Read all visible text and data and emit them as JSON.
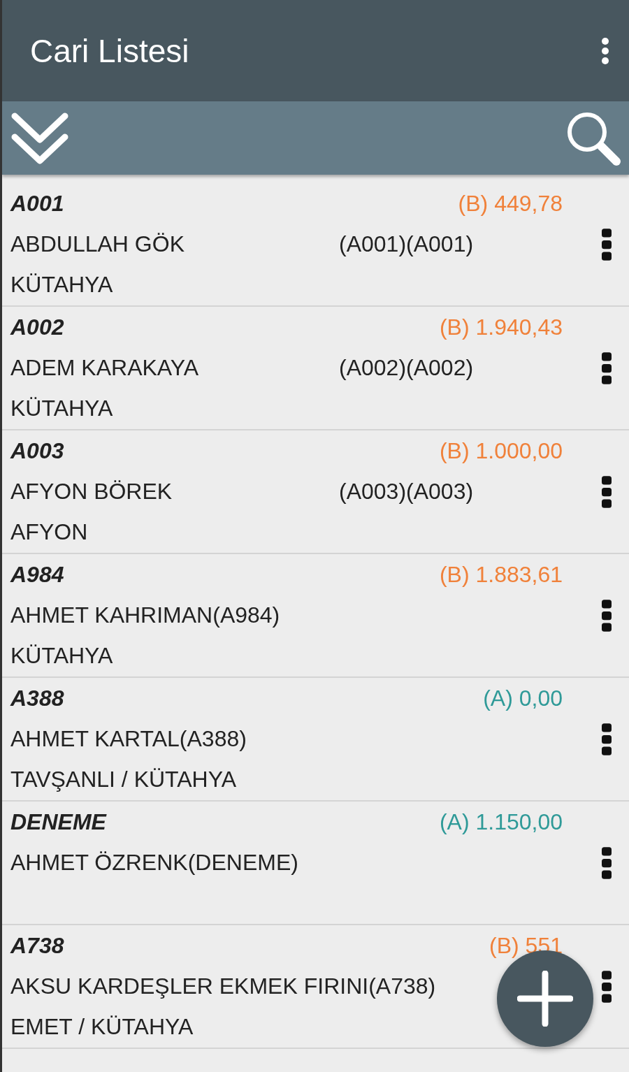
{
  "app_bar": {
    "title": "Cari Listesi"
  },
  "rows": [
    {
      "code": "A001",
      "balance": "(B) 449,78",
      "color": "#f0813a",
      "name": "ABDULLAH GÖK",
      "name_suffix": "(A001)(A001)",
      "city": "KÜTAHYA"
    },
    {
      "code": "A002",
      "balance": "(B) 1.940,43",
      "color": "#f0813a",
      "name": "ADEM KARAKAYA",
      "name_suffix": "(A002)(A002)",
      "city": "KÜTAHYA"
    },
    {
      "code": "A003",
      "balance": "(B) 1.000,00",
      "color": "#f0813a",
      "name": "AFYON BÖREK",
      "name_suffix": "(A003)(A003)",
      "city": "AFYON"
    },
    {
      "code": "A984",
      "balance": "(B) 1.883,61",
      "color": "#f0813a",
      "name": "AHMET KAHRIMAN(A984)",
      "city": "KÜTAHYA"
    },
    {
      "code": "A388",
      "balance": "(A) 0,00",
      "color": "#2f9a98",
      "name": "AHMET KARTAL(A388)",
      "city": "TAVŞANLI / KÜTAHYA"
    },
    {
      "code": "DENEME",
      "balance": "(A) 1.150,00",
      "color": "#2f9a98",
      "name": "AHMET ÖZRENK(DENEME)"
    },
    {
      "code": "A738",
      "balance": "(B) 551",
      "color": "#f0813a",
      "name": "AKSU KARDEŞLER EKMEK FIRINI(A738)",
      "city": "EMET / KÜTAHYA"
    }
  ]
}
